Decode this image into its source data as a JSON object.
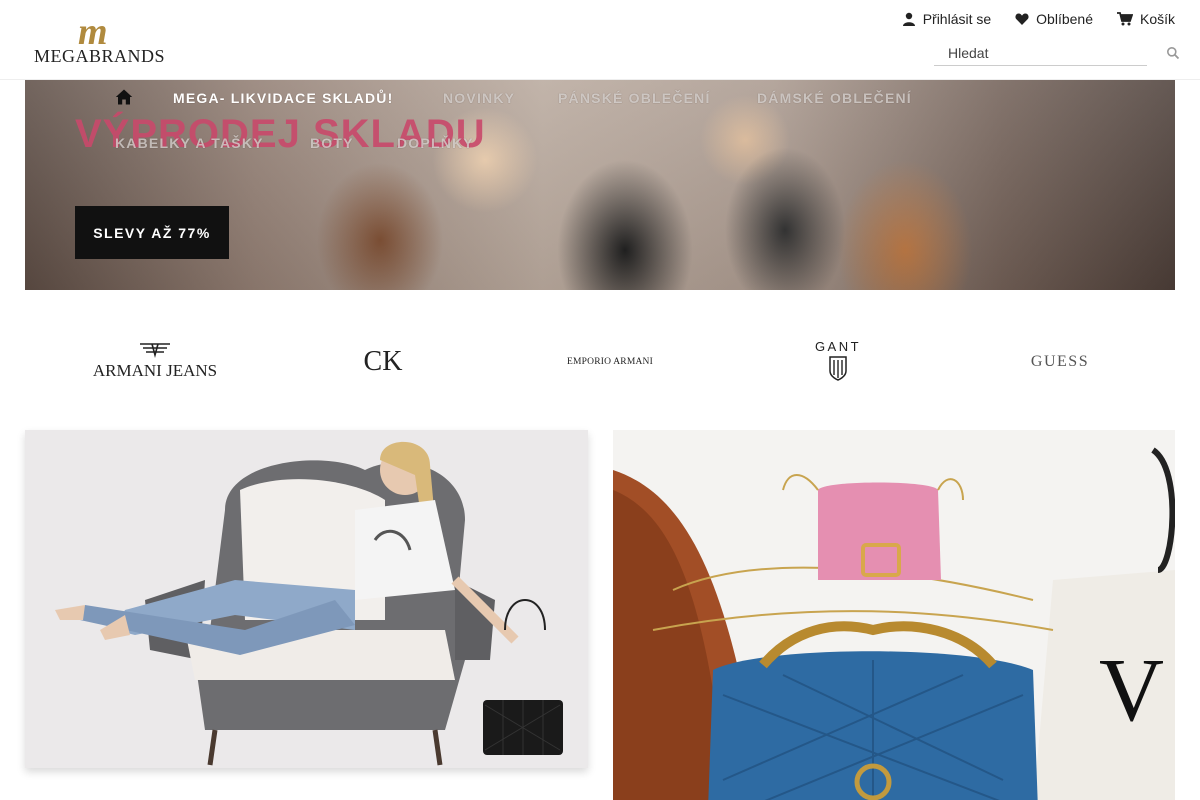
{
  "header": {
    "logo_mark": "m",
    "logo_text": "MEGABRANDS",
    "links": {
      "login": "Přihlásit se",
      "favorites": "Oblíbené",
      "cart": "Košík"
    },
    "search": {
      "placeholder": "Hledat"
    }
  },
  "nav": {
    "items": [
      {
        "label": "MEGA- LIKVIDACE SKLADŮ!"
      },
      {
        "label": "NOVINKY"
      },
      {
        "label": "PÁNSKÉ OBLEČENÍ"
      },
      {
        "label": "DÁMSKÉ OBLEČENÍ"
      },
      {
        "label": "KABELKY A TAŠKY"
      },
      {
        "label": "BOTY"
      },
      {
        "label": "DOPLŇKY"
      }
    ]
  },
  "hero": {
    "title": "VÝPRODEJ SKLADU",
    "button": "SLEVY AŽ 77%"
  },
  "brands": {
    "armani_jeans": "ARMANI JEANS",
    "ck": "CK",
    "emporio_armani": "EMPORIO ARMANI",
    "gant": "GANT",
    "guess": "GUESS"
  },
  "colors": {
    "logo_gold": "#b08a3e",
    "hero_title": "#c9496b",
    "button_bg": "#111111"
  },
  "icons": [
    "user-icon",
    "heart-icon",
    "cart-icon",
    "search-icon",
    "home-icon"
  ]
}
